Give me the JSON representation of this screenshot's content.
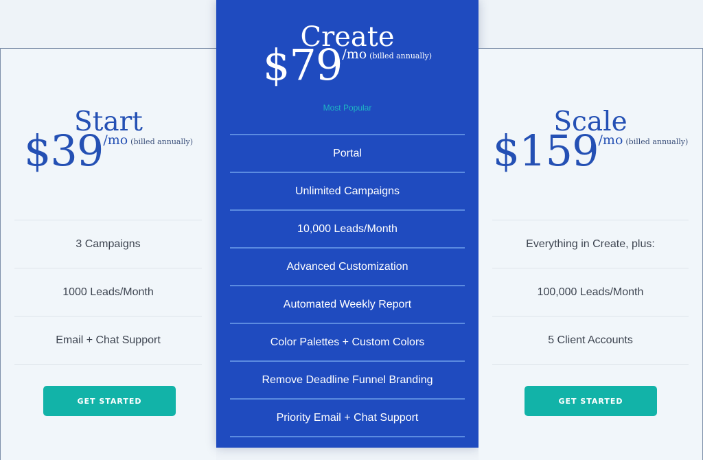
{
  "plans": {
    "start": {
      "name": "Start",
      "price": "$39",
      "period": "/mo",
      "billing_note": "(billed annually)",
      "features": [
        "3 Campaigns",
        "1000 Leads/Month",
        "Email + Chat Support"
      ],
      "cta_label": "GET STARTED"
    },
    "create": {
      "name": "Create",
      "price": "$79",
      "period": "/mo",
      "billing_note": "(billed annually)",
      "badge": "Most Popular",
      "features": [
        "Portal",
        "Unlimited Campaigns",
        "10,000 Leads/Month",
        "Advanced Customization",
        "Automated Weekly Report",
        "Color Palettes + Custom Colors",
        "Remove Deadline Funnel Branding",
        "Priority Email + Chat Support"
      ]
    },
    "scale": {
      "name": "Scale",
      "price": "$159",
      "period": "/mo",
      "billing_note": "(billed annually)",
      "features": [
        "Everything in Create, plus:",
        "100,000 Leads/Month",
        "5 Client Accounts"
      ],
      "cta_label": "GET STARTED"
    }
  },
  "colors": {
    "featured_bg": "#1f4bbf",
    "heading_blue": "#2450b4",
    "cta_teal": "#12b3a8",
    "badge_teal": "#1fb5c2"
  }
}
